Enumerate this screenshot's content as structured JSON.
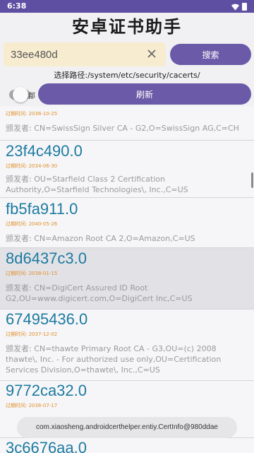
{
  "status_bar": {
    "time": "6:38",
    "icons": [
      "wifi-icon",
      "battery-icon"
    ]
  },
  "app": {
    "title": "安卓证书助手"
  },
  "search": {
    "value": "33ee480d",
    "button_label": "搜索"
  },
  "path_text": "选择路径:/system/etc/security/cacerts/",
  "toggle": {
    "label": "全部",
    "state": "off"
  },
  "refresh_label": "刷新",
  "colors": {
    "accent": "#6a5aa8",
    "status_bar": "#5f4fa3",
    "hash": "#1d7aa0",
    "date": "#e08e2a",
    "search_bg": "#f8ecd0"
  },
  "certs": [
    {
      "hash": "",
      "date": "过期时间: 2036-10-25",
      "issuer": "颁发者: CN=SwissSign Silver CA - G2,O=SwissSign AG,C=CH",
      "highlighted": false
    },
    {
      "hash": "23f4c490.0",
      "date": "过期时间: 2034-06-30",
      "issuer": "颁发者: OU=Starfield Class 2 Certification Authority,O=Starfield Technologies\\, Inc.,C=US",
      "highlighted": false
    },
    {
      "hash": "fb5fa911.0",
      "date": "过期时间: 2040-05-26",
      "issuer": "颁发者: CN=Amazon Root CA 2,O=Amazon,C=US",
      "highlighted": false
    },
    {
      "hash": "8d6437c3.0",
      "date": "过期时间: 2038-01-15",
      "issuer": "颁发者: CN=DigiCert Assured ID Root G2,OU=www.digicert.com,O=DigiCert Inc,C=US",
      "highlighted": true
    },
    {
      "hash": "67495436.0",
      "date": "过期时间: 2037-12-02",
      "issuer": "颁发者: CN=thawte Primary Root CA - G3,OU=(c) 2008 thawte\\, Inc. - For authorized use only,OU=Certification Services Division,O=thawte\\, Inc.,C=US",
      "highlighted": false
    },
    {
      "hash": "9772ca32.0",
      "date": "过期时间: 2036-07-17",
      "issuer": "",
      "highlighted": false
    },
    {
      "hash": "3c6676aa.0",
      "date": "",
      "issuer": "",
      "highlighted": false
    }
  ],
  "toast": {
    "text": "com.xiaosheng.androidcerthelper.entiy.CertInfo@980ddae"
  }
}
